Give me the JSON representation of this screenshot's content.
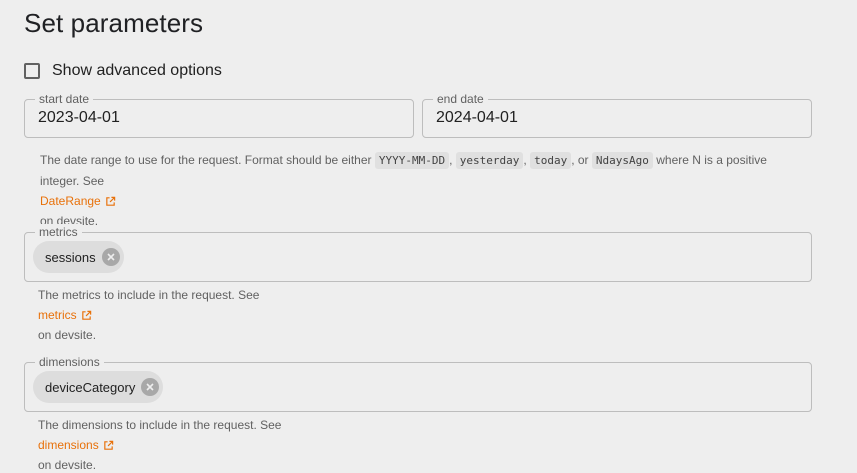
{
  "title": "Set parameters",
  "advanced": {
    "label": "Show advanced options",
    "checked": false
  },
  "start_date": {
    "label": "start date",
    "value": "2023-04-01"
  },
  "end_date": {
    "label": "end date",
    "value": "2024-04-01"
  },
  "date_help": {
    "text1": "The date range to use for the request. Format should be either",
    "tokens": [
      "YYYY-MM-DD",
      "yesterday",
      "today",
      "NdaysAgo"
    ],
    "sep1": ",",
    "sep2": ",",
    "sep3": ", or",
    "text2": "where N is a positive",
    "text3": "integer. See",
    "link": "DateRange",
    "suffix": "on devsite."
  },
  "metrics": {
    "label": "metrics",
    "chips": [
      "sessions"
    ],
    "help_text": "The metrics to include in the request. See",
    "link": "metrics",
    "suffix": "on devsite."
  },
  "dimensions": {
    "label": "dimensions",
    "chips": [
      "deviceCategory"
    ],
    "help_text": "The dimensions to include in the request. See",
    "link": "dimensions",
    "suffix": "on devsite."
  },
  "colors": {
    "link": "#e8710a",
    "background": "#eeeeee"
  }
}
